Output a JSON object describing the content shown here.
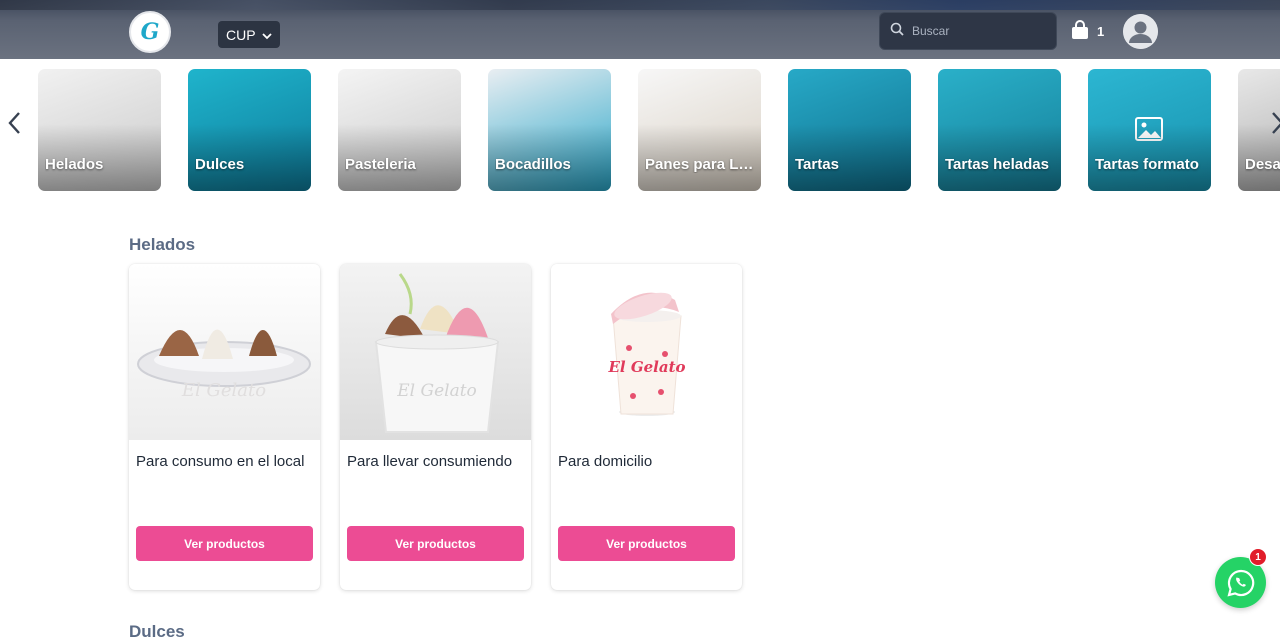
{
  "header": {
    "logo_text": "G",
    "currency": "CUP",
    "search_placeholder": "Buscar",
    "cart_count": "1"
  },
  "categories": [
    {
      "label": "Helados",
      "colors": [
        "#f1f1f1",
        "#c9c9c9"
      ]
    },
    {
      "label": "Dulces",
      "colors": [
        "#1fb4cc",
        "#0e7b9a"
      ]
    },
    {
      "label": "Pasteleria",
      "colors": [
        "#f4f4f4",
        "#c8c8c8"
      ]
    },
    {
      "label": "Bocadillos",
      "colors": [
        "#e9eef2",
        "#29a6c8"
      ]
    },
    {
      "label": "Panes para LLevar",
      "colors": [
        "#f7f7f7",
        "#d8cfc2"
      ]
    },
    {
      "label": "Tartas",
      "colors": [
        "#27a9c7",
        "#0f6f8c"
      ]
    },
    {
      "label": "Tartas heladas",
      "colors": [
        "#2ab0c9",
        "#157e98"
      ]
    },
    {
      "label": "Tartas formato",
      "colors": [
        "#2cb6d2",
        "#1891ad"
      ]
    },
    {
      "label": "Desayunos",
      "colors": [
        "#e8e8e8",
        "#a8a8a8"
      ]
    }
  ],
  "sections": [
    {
      "title": "Helados",
      "products": [
        {
          "title": "Para consumo en el local",
          "button": "Ver productos"
        },
        {
          "title": "Para llevar consumiendo",
          "button": "Ver productos"
        },
        {
          "title": "Para domicilio",
          "button": "Ver productos"
        }
      ]
    },
    {
      "title": "Dulces"
    }
  ],
  "whatsapp": {
    "badge": "1"
  },
  "colors": {
    "accent": "#ec4c94",
    "header": "#5a6272",
    "section_title": "#5b6b85",
    "whatsapp": "#25d366"
  }
}
